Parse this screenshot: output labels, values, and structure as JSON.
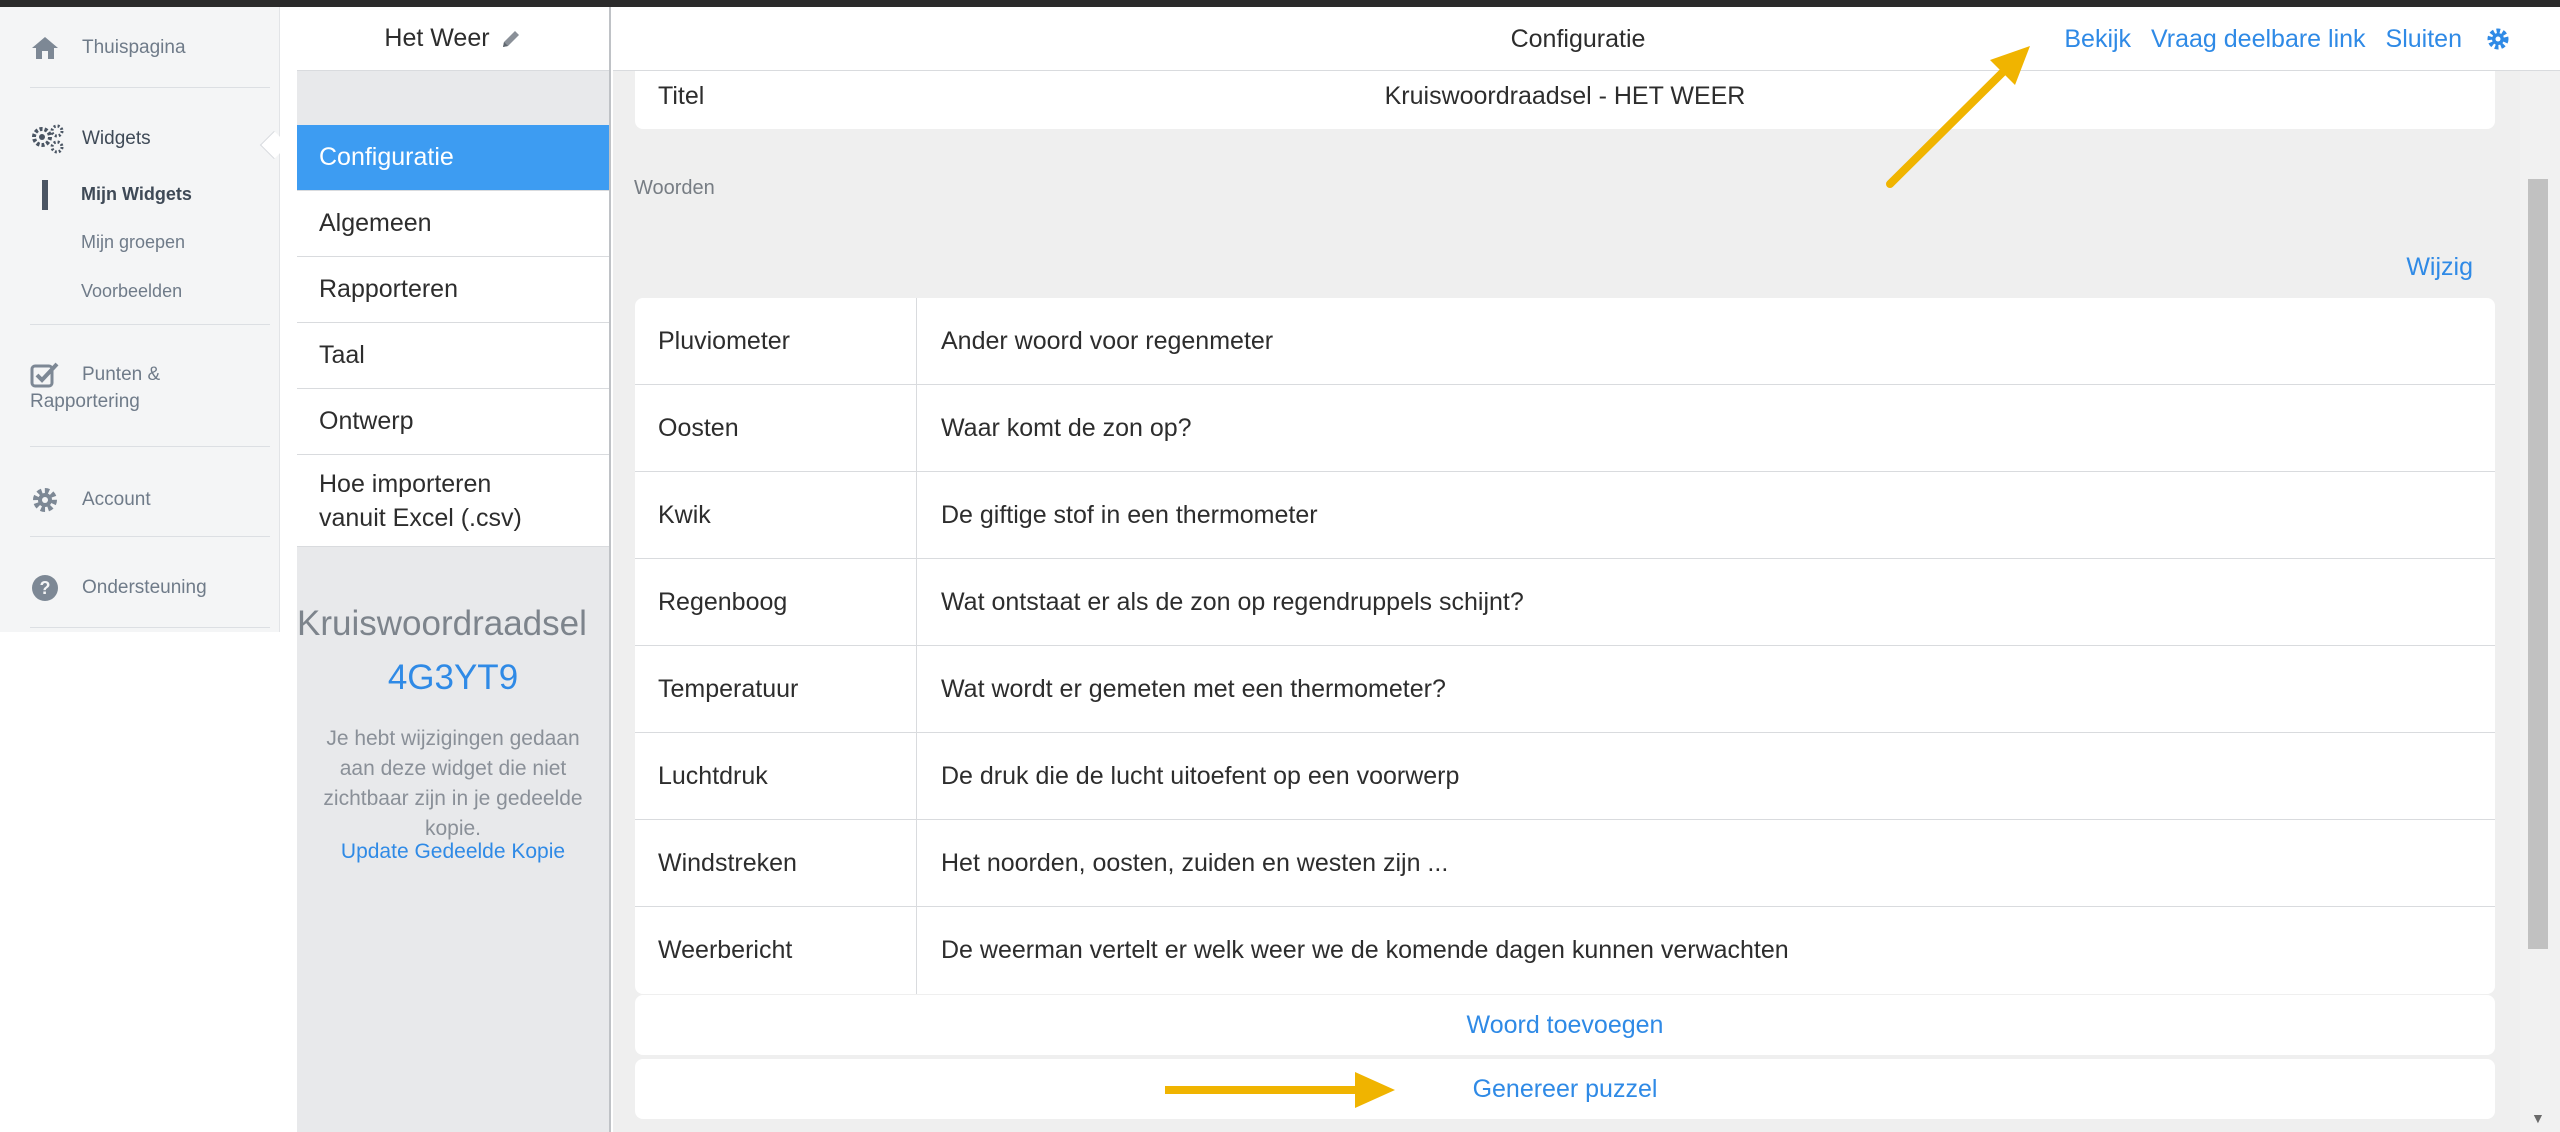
{
  "sidebar": {
    "home": "Thuispagina",
    "widgets": "Widgets",
    "my_widgets": "Mijn Widgets",
    "my_groups": "Mijn groepen",
    "examples": "Voorbeelden",
    "points_line1": "Punten &",
    "points_line2": "Rapportering",
    "account": "Account",
    "support": "Ondersteuning"
  },
  "config_column": {
    "widget_title": "Het Weer",
    "menu": [
      {
        "label": "Configuratie",
        "active": true
      },
      {
        "label": "Algemeen"
      },
      {
        "label": "Rapporteren"
      },
      {
        "label": "Taal"
      },
      {
        "label": "Ontwerp"
      },
      {
        "label_line1": "Hoe importeren",
        "label_line2": "vanuit Excel (.csv)"
      }
    ],
    "widget_type": "Kruiswoordraadsel",
    "widget_code": "4G3YT9",
    "notice": "Je hebt wijzigingen gedaan aan deze widget die niet zichtbaar zijn in je gedeelde kopie.",
    "update_link": "Update Gedeelde Kopie"
  },
  "header": {
    "title": "Configuratie",
    "view": "Bekijk",
    "share_link": "Vraag deelbare link",
    "close": "Sluiten"
  },
  "title_row": {
    "label": "Titel",
    "value": "Kruiswoordraadsel - HET WEER"
  },
  "words_section": {
    "label": "Woorden",
    "edit": "Wijzig",
    "rows": [
      {
        "term": "Pluviometer",
        "clue": "Ander woord voor regenmeter"
      },
      {
        "term": "Oosten",
        "clue": "Waar komt de zon op?"
      },
      {
        "term": "Kwik",
        "clue": "De giftige stof in een thermometer"
      },
      {
        "term": "Regenboog",
        "clue": "Wat ontstaat er als de zon op regendruppels schijnt?"
      },
      {
        "term": "Temperatuur",
        "clue": "Wat wordt er gemeten met een thermometer?"
      },
      {
        "term": "Luchtdruk",
        "clue": "De druk die de lucht uitoefent op een voorwerp"
      },
      {
        "term": "Windstreken",
        "clue": "Het noorden, oosten, zuiden en westen zijn ..."
      },
      {
        "term": "Weerbericht",
        "clue": "De weerman vertelt er welk weer we de komende dagen kunnen verwachten"
      }
    ],
    "add_word": "Woord toevoegen",
    "generate": "Genereer puzzel"
  },
  "colors": {
    "accent": "#2f8ae6",
    "active_menu": "#3d9cf2",
    "annotation_arrow": "#f0b400"
  }
}
